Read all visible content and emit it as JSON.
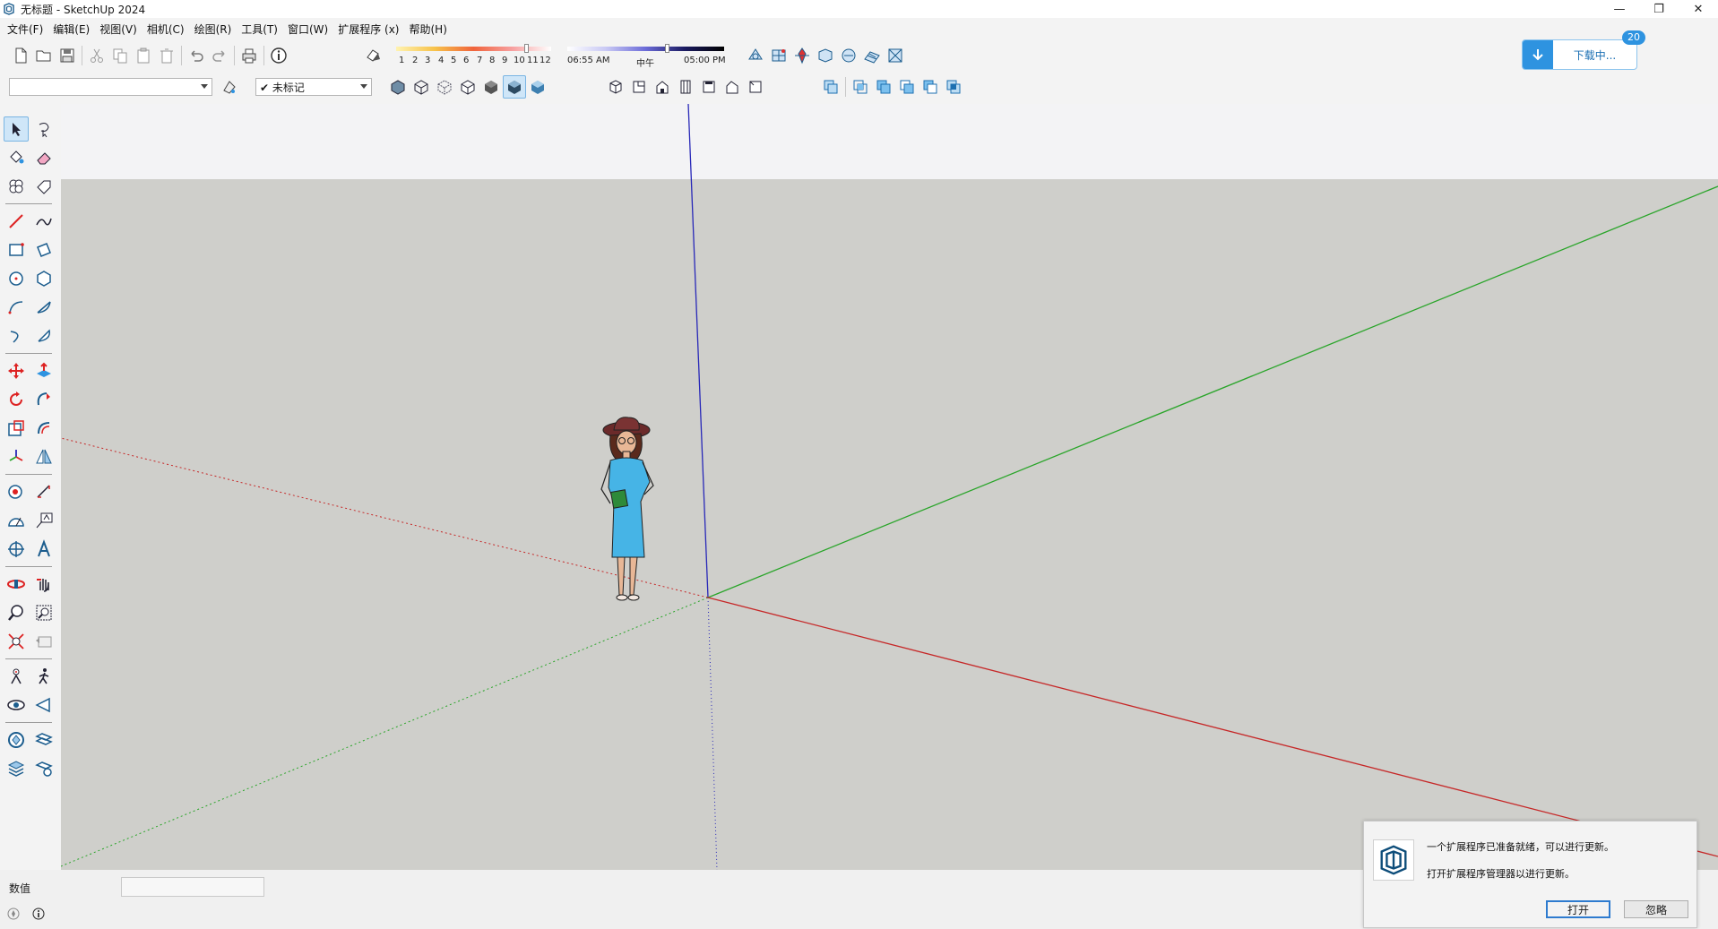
{
  "window": {
    "title": "无标题 - SketchUp 2024",
    "controls": {
      "minimize": "—",
      "restore": "❐",
      "close": "✕"
    }
  },
  "menu": {
    "items": [
      "文件(F)",
      "编辑(E)",
      "视图(V)",
      "相机(C)",
      "绘图(R)",
      "工具(T)",
      "窗口(W)",
      "扩展程序 (x)",
      "帮助(H)"
    ]
  },
  "shadow": {
    "month_ticks": [
      "1",
      "2",
      "3",
      "4",
      "5",
      "6",
      "7",
      "8",
      "9",
      "10",
      "11",
      "12"
    ],
    "time_start": "06:55 AM",
    "time_mid": "中午",
    "time_end": "05:00 PM"
  },
  "download": {
    "label": "下载中...",
    "badge": "20"
  },
  "toolbar2": {
    "layer_combo_value": "",
    "tag_combo_value": "✔ 未标记"
  },
  "icons": {
    "standard": [
      "new-file-icon",
      "open-folder-icon",
      "save-icon",
      "cut-icon",
      "copy-icon",
      "paste-icon",
      "delete-icon",
      "undo-icon",
      "redo-icon",
      "print-icon",
      "model-info-icon"
    ],
    "styles": [
      "xray-icon",
      "back-edges-icon",
      "wireframe-icon",
      "hidden-line-icon",
      "shaded-icon",
      "shaded-textures-icon",
      "monochrome-icon"
    ],
    "views": [
      "iso-view-icon",
      "top-view-icon",
      "front-view-icon",
      "right-view-icon",
      "back-view-icon",
      "left-view-icon",
      "bottom-view-icon"
    ]
  },
  "vcb": {
    "label": "数值",
    "value": ""
  },
  "notification": {
    "line1": "一个扩展程序已准备就绪，可以进行更新。",
    "line2": "打开扩展程序管理器以进行更新。",
    "open_label": "打开",
    "ignore_label": "忽略"
  },
  "colors": {
    "accent": "#2e93e0",
    "viewport_ground": "#cfcfcb",
    "sky": "#f3f3f5",
    "axis_red": "#c62828",
    "axis_green": "#2aa52a",
    "axis_blue": "#2828b8"
  }
}
